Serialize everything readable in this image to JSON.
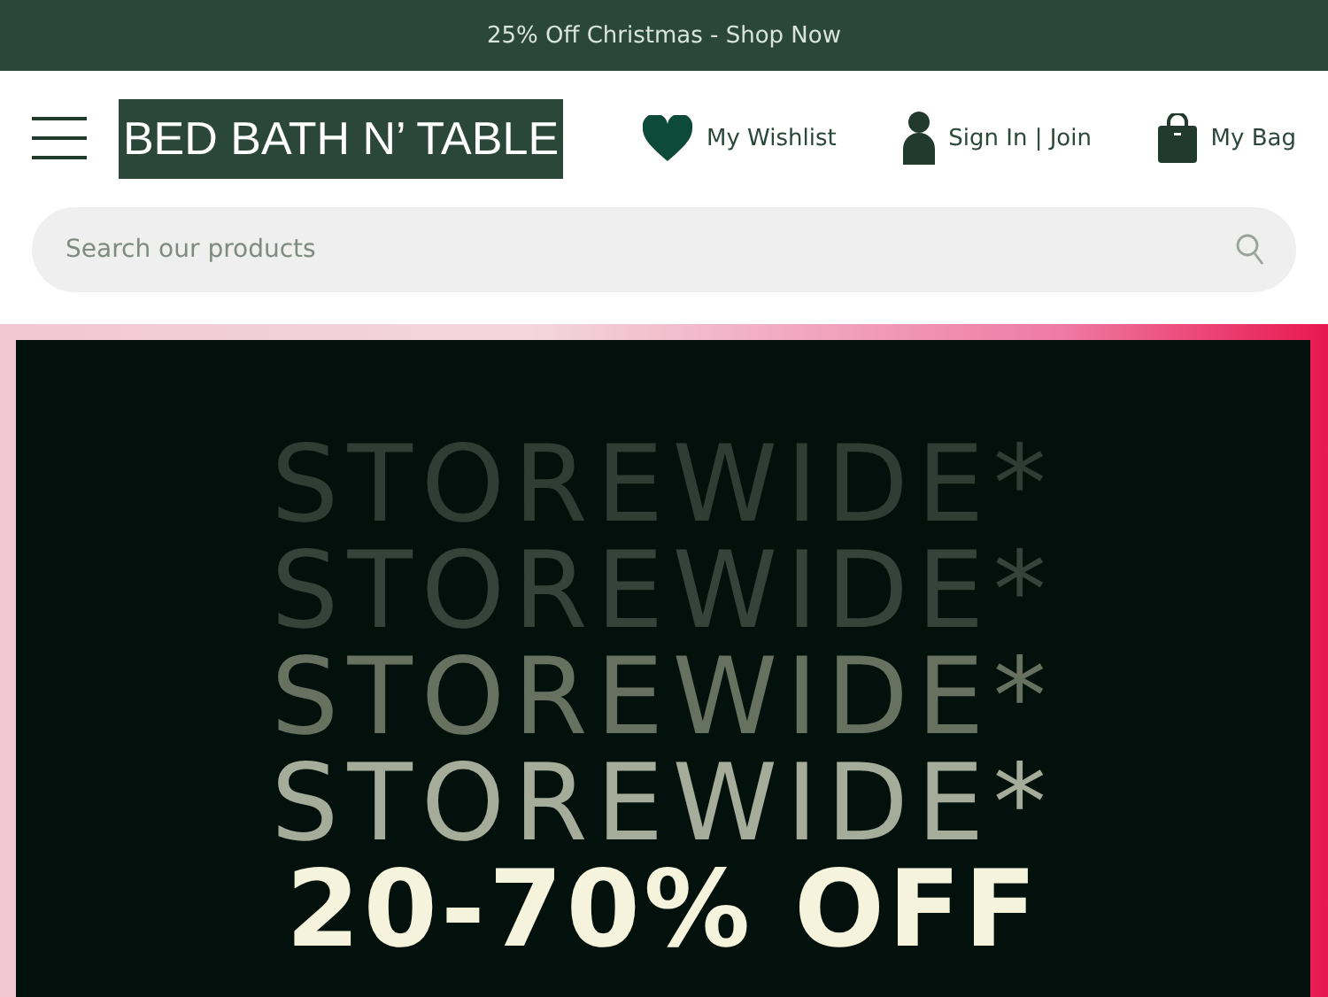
{
  "promo_bar": {
    "text": "25% Off Christmas - Shop Now"
  },
  "header": {
    "logo": "BED BATH N’ TABLE",
    "links": [
      {
        "kind": "wishlist",
        "label": "My Wishlist"
      },
      {
        "kind": "account",
        "label": "Sign In | Join"
      },
      {
        "kind": "bag",
        "label": "My Bag"
      }
    ]
  },
  "search": {
    "placeholder": "Search our products"
  },
  "hero": {
    "lines": [
      {
        "text": "STOREWIDE*",
        "color": "#2f3d35"
      },
      {
        "text": "STOREWIDE*",
        "color": "#35443b"
      },
      {
        "text": "STOREWIDE*",
        "color": "#66725f"
      },
      {
        "text": "STOREWIDE*",
        "color": "#a5ac99"
      },
      {
        "text": "20-70% OFF",
        "color": "#f6f3dc"
      }
    ]
  }
}
